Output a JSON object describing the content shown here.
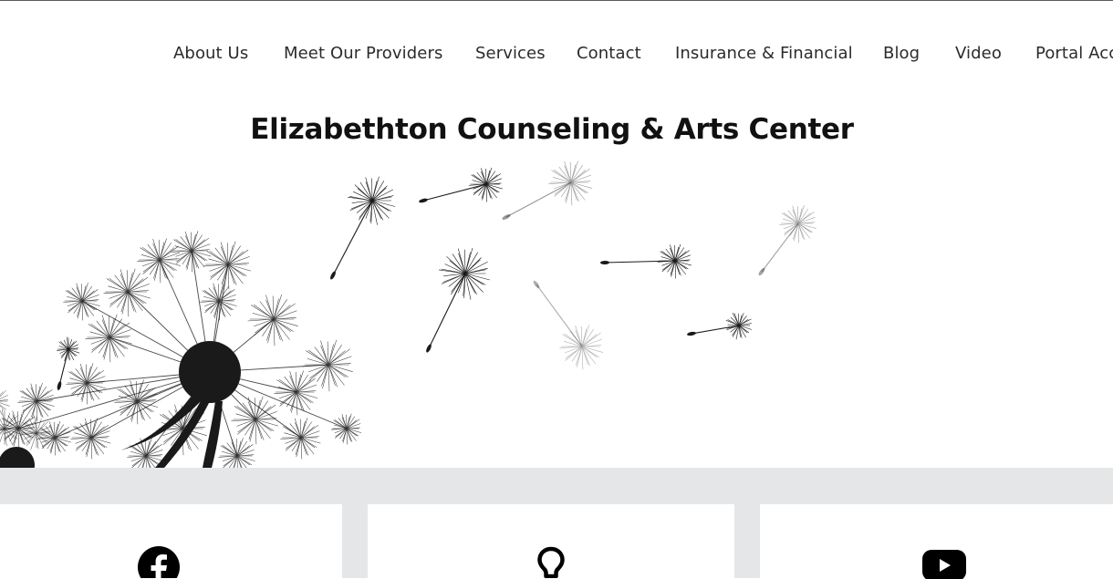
{
  "nav": {
    "items": [
      {
        "label": "About Us"
      },
      {
        "label": "Meet Our Providers"
      },
      {
        "label": "Services"
      },
      {
        "label": "Contact"
      },
      {
        "label": "Insurance & Financial"
      },
      {
        "label": "Blog"
      },
      {
        "label": "Video"
      },
      {
        "label": "Portal Acc"
      }
    ]
  },
  "header": {
    "title": "Elizabethton Counseling & Arts Center"
  },
  "hero": {
    "image": "dandelion-seeds-illustration"
  },
  "cards": [
    {
      "icon": "facebook-icon"
    },
    {
      "icon": "lightbulb-icon"
    },
    {
      "icon": "youtube-icon"
    }
  ],
  "colors": {
    "text": "#2b2b2b",
    "title": "#111111",
    "band": "#e5e6e8",
    "ink": "#1a1a1a"
  }
}
